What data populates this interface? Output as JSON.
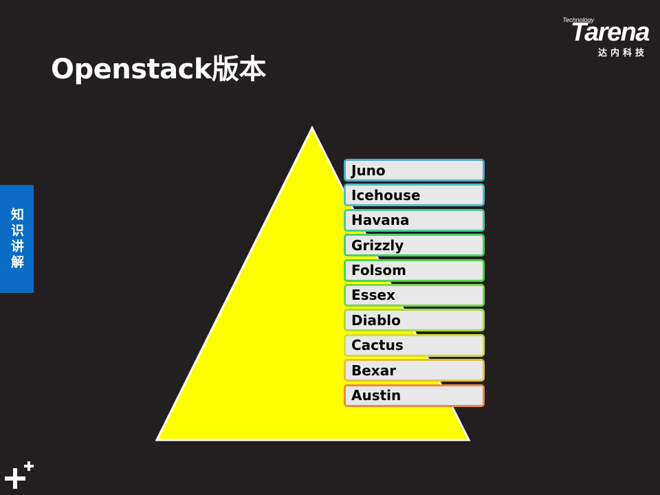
{
  "slide": {
    "title": "Openstack版本",
    "side_tab": "知识讲解"
  },
  "logo": {
    "tagline": "Technology",
    "wordmark": "Tarena",
    "chinese": "达内科技"
  },
  "releases": [
    {
      "name": "Juno",
      "border": "#56a9c6"
    },
    {
      "name": "Icehouse",
      "border": "#4fbfbf"
    },
    {
      "name": "Havana",
      "border": "#4cc99a"
    },
    {
      "name": "Grizzly",
      "border": "#49d068"
    },
    {
      "name": "Folsom",
      "border": "#4ed44a"
    },
    {
      "name": "Essex",
      "border": "#7ad640"
    },
    {
      "name": "Diablo",
      "border": "#a9d93c"
    },
    {
      "name": "Cactus",
      "border": "#d6dc38"
    },
    {
      "name": "Bexar",
      "border": "#e3c03e"
    },
    {
      "name": "Austin",
      "border": "#e88b44"
    }
  ],
  "colors": {
    "background": "#231f20",
    "pyramid_fill": "#ffff00",
    "side_tab": "#0a6cc4"
  }
}
